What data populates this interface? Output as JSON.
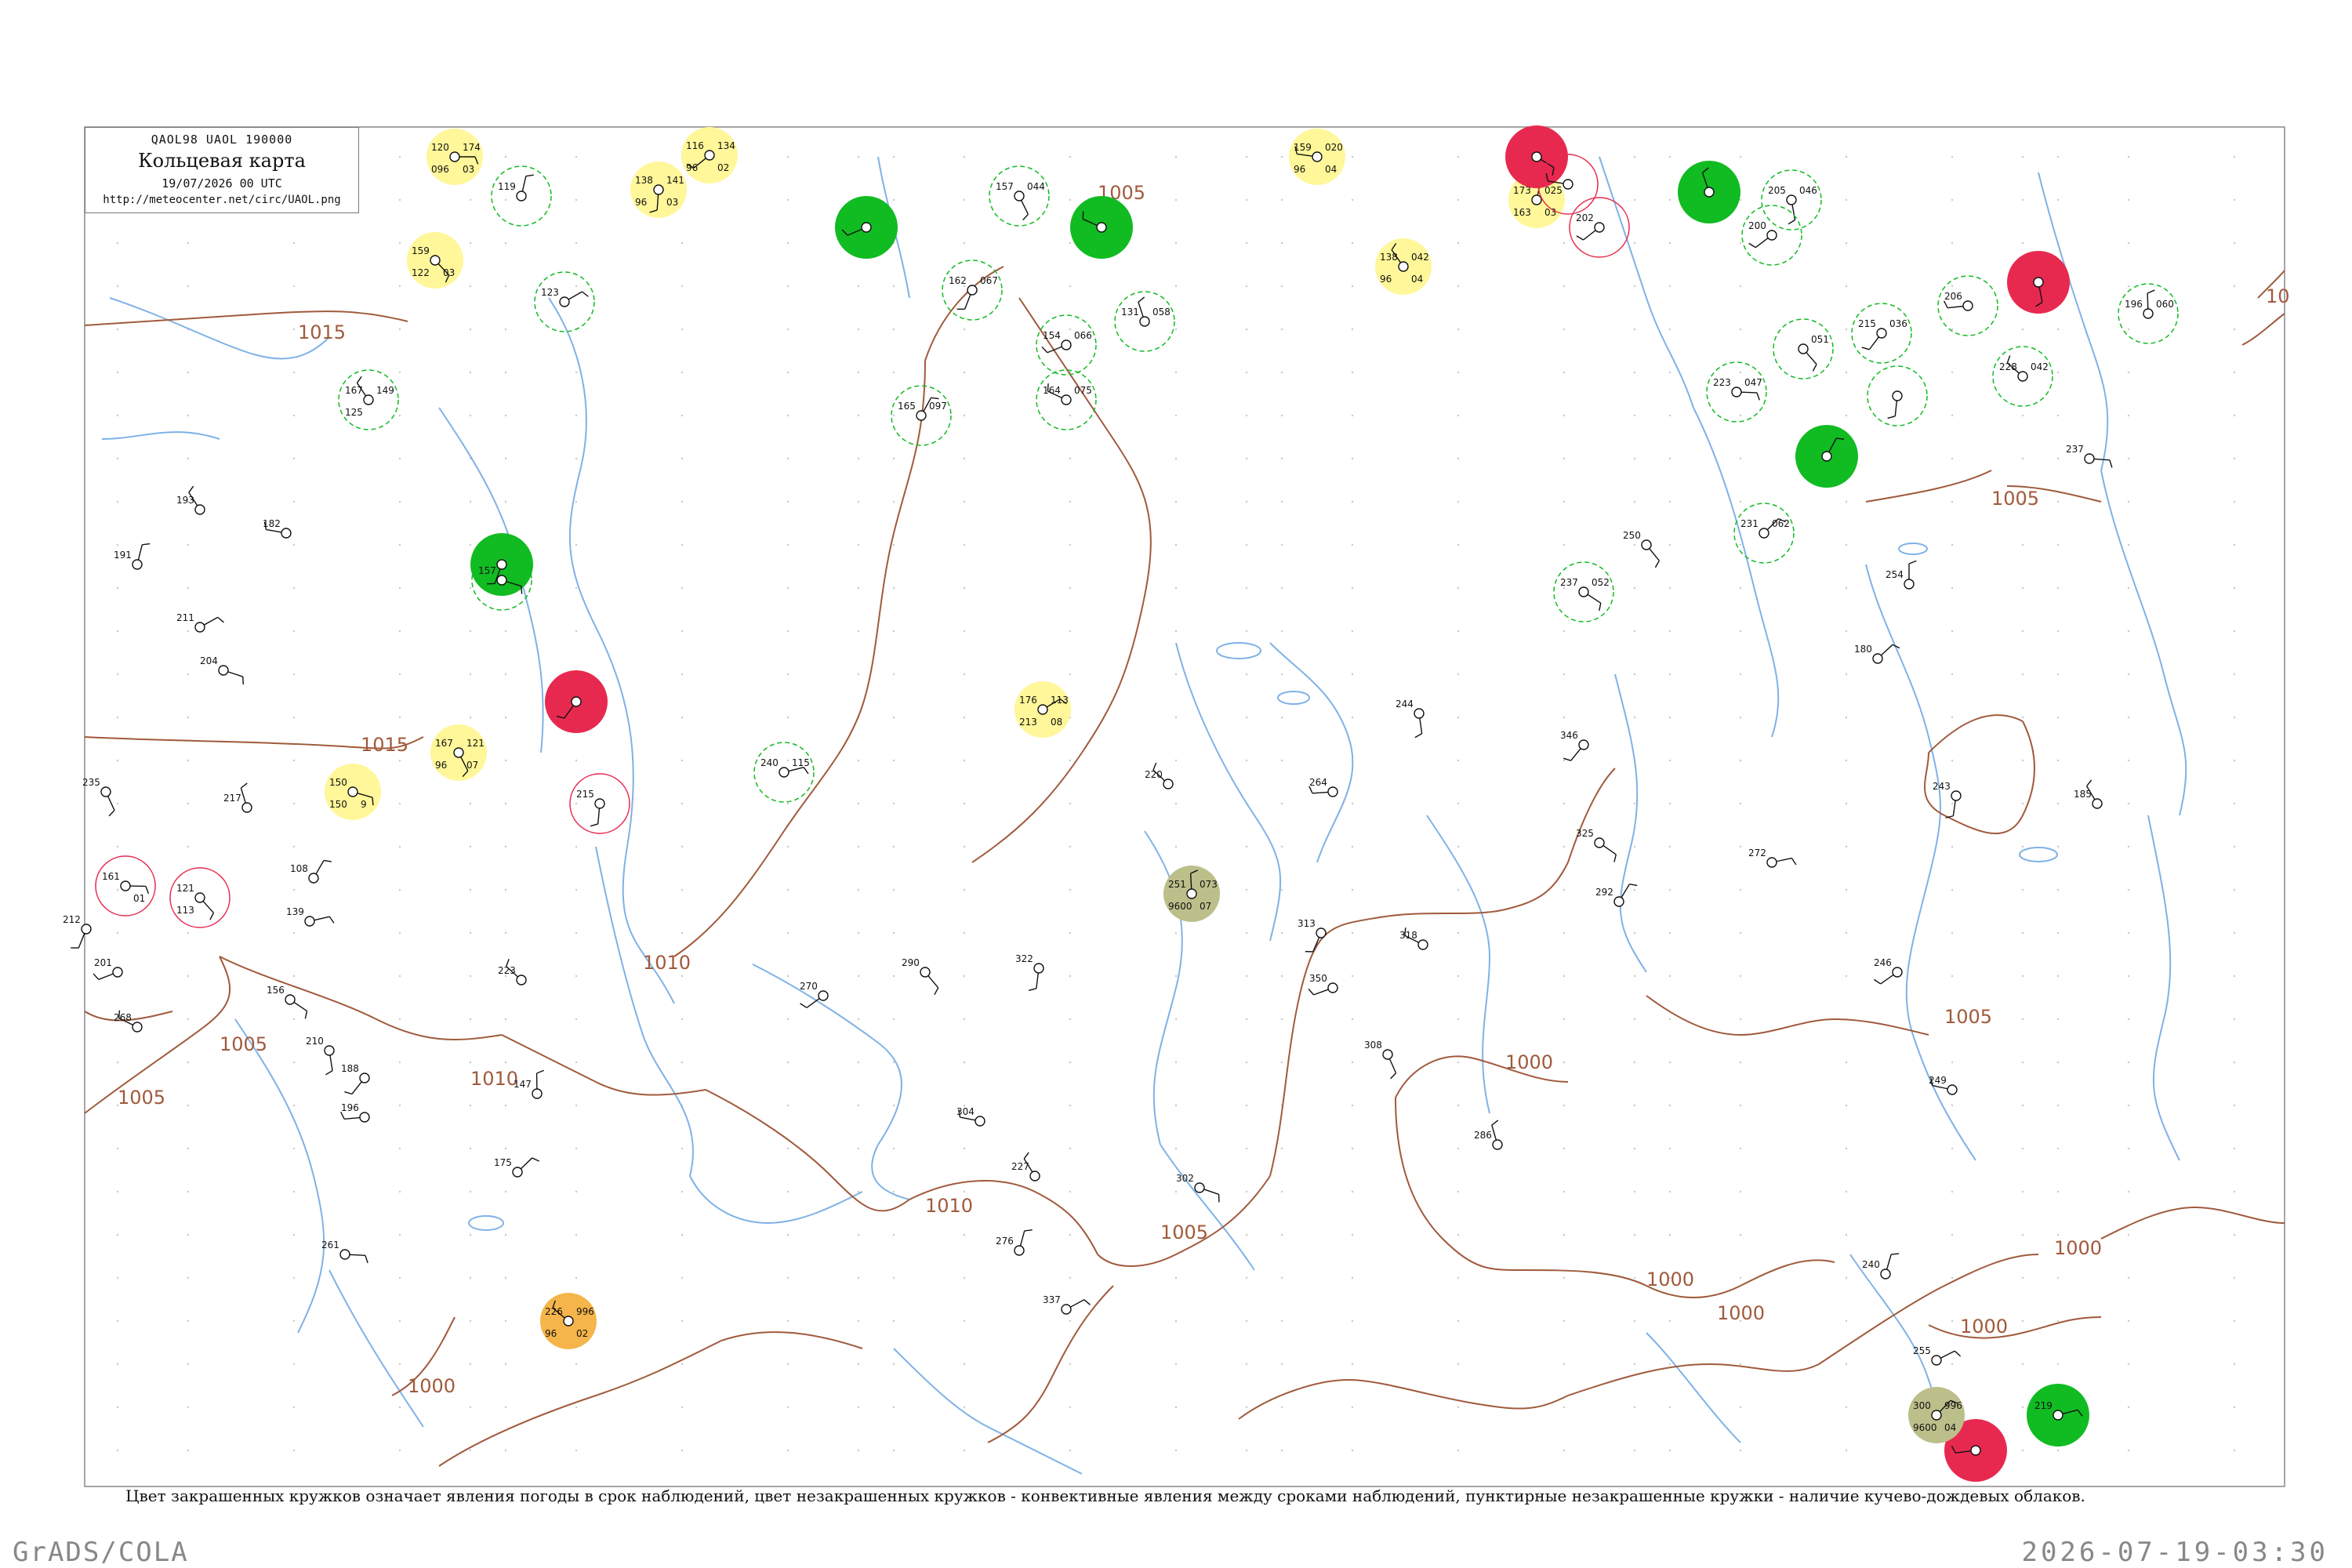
{
  "header": {
    "codes": "QAOL98 UAOL 190000",
    "title": "Кольцевая карта",
    "datetime": "19/07/2026 00 UTC",
    "url": "http://meteocenter.net/circ/UAOL.png"
  },
  "caption": "Цвет закрашенных кружков означает явления погоды в срок наблюдений, цвет незакрашенных кружков - конвективные явления между сроками наблюдений, пунктирные незакрашенные кружки - наличие кучево-дождевых облаков.",
  "footer": {
    "left": "GrADS/COLA",
    "right": "2026-07-19-03:30"
  },
  "colors": {
    "yellow": "#fff799",
    "green": "#11bb22",
    "red": "#e8294f",
    "orange": "#f5b54a",
    "olive": "#bcbf8a",
    "isobar": "#a05a3c",
    "river": "#7fb2e6",
    "frame": "#888888"
  },
  "isobar_labels": [
    "1015",
    "1015",
    "1010",
    "1010",
    "1005",
    "1005",
    "1005",
    "1005",
    "1000",
    "1000",
    "1000",
    "1000",
    "1000",
    "1000",
    "1005",
    "1010",
    "1005",
    "10"
  ],
  "stations": [
    {
      "t": "120",
      "p": "174",
      "td": "096",
      "pt": "03",
      "s": "yellow"
    },
    {
      "t": "159",
      "p": "",
      "td": "122",
      "pt": "03",
      "s": "yellow"
    },
    {
      "t": "138",
      "p": "141",
      "td": "96",
      "pt": "03",
      "s": "yellow"
    },
    {
      "t": "116",
      "p": "134",
      "td": "96",
      "pt": "02",
      "s": "yellow"
    },
    {
      "t": "159",
      "p": "020",
      "td": "96",
      "pt": "04",
      "s": "yellow"
    },
    {
      "t": "138",
      "p": "042",
      "td": "96",
      "pt": "04",
      "s": "yellow"
    },
    {
      "t": "173",
      "p": "025",
      "td": "163",
      "pt": "03",
      "s": "yellow"
    },
    {
      "t": "176",
      "p": "113",
      "td": "213",
      "pt": "08",
      "s": "yellow"
    },
    {
      "t": "150",
      "p": "",
      "td": "150",
      "pt": "9",
      "s": "yellow"
    },
    {
      "t": "167",
      "p": "121",
      "td": "96",
      "pt": "07",
      "s": "yellow"
    },
    {
      "t": "",
      "p": "",
      "td": "",
      "pt": "",
      "s": "green"
    },
    {
      "t": "",
      "p": "",
      "td": "",
      "pt": "",
      "s": "green"
    },
    {
      "t": "",
      "p": "",
      "td": "",
      "pt": "",
      "s": "green"
    },
    {
      "t": "",
      "p": "",
      "td": "",
      "pt": "",
      "s": "green"
    },
    {
      "t": "",
      "p": "",
      "td": "",
      "pt": "",
      "s": "green"
    },
    {
      "t": "219",
      "p": "",
      "td": "",
      "pt": "",
      "s": "green"
    },
    {
      "t": "",
      "p": "",
      "td": "",
      "pt": "",
      "s": "red"
    },
    {
      "t": "",
      "p": "",
      "td": "",
      "pt": "",
      "s": "red"
    },
    {
      "t": "",
      "p": "",
      "td": "",
      "pt": "",
      "s": "red"
    },
    {
      "t": "",
      "p": "",
      "td": "",
      "pt": "",
      "s": "red"
    },
    {
      "t": "226",
      "p": "996",
      "td": "96",
      "pt": "02",
      "s": "orange"
    },
    {
      "t": "251",
      "p": "073",
      "td": "9600",
      "pt": "07",
      "s": "olive"
    },
    {
      "t": "300",
      "p": "996",
      "td": "9600",
      "pt": "04",
      "s": "olive"
    },
    {
      "t": "161",
      "p": "",
      "td": "",
      "pt": "01",
      "s": "ring-red"
    },
    {
      "t": "121",
      "p": "",
      "td": "113",
      "pt": "",
      "s": "ring-red"
    },
    {
      "t": "215",
      "p": "",
      "td": "",
      "pt": "",
      "s": "ring-red"
    },
    {
      "t": "202",
      "p": "",
      "td": "",
      "pt": "",
      "s": "ring-red"
    },
    {
      "t": "",
      "p": "",
      "td": "",
      "pt": "",
      "s": "ring-red"
    },
    {
      "t": "167",
      "p": "149",
      "td": "125",
      "pt": "",
      "s": "ring-green"
    },
    {
      "t": "119",
      "p": "",
      "td": "",
      "pt": "",
      "s": "ring-green"
    },
    {
      "t": "123",
      "p": "",
      "td": "",
      "pt": "",
      "s": "ring-green"
    },
    {
      "t": "157",
      "p": "",
      "td": "",
      "pt": "",
      "s": "ring-green"
    },
    {
      "t": "157",
      "p": "044",
      "td": "",
      "pt": "",
      "s": "ring-green"
    },
    {
      "t": "162",
      "p": "067",
      "td": "",
      "pt": "",
      "s": "ring-green"
    },
    {
      "t": "154",
      "p": "066",
      "td": "",
      "pt": "",
      "s": "ring-green"
    },
    {
      "t": "164",
      "p": "075",
      "td": "",
      "pt": "",
      "s": "ring-green"
    },
    {
      "t": "131",
      "p": "058",
      "td": "",
      "pt": "",
      "s": "ring-green"
    },
    {
      "t": "165",
      "p": "097",
      "td": "",
      "pt": "",
      "s": "ring-green"
    },
    {
      "t": "240",
      "p": "115",
      "td": "",
      "pt": "",
      "s": "ring-green"
    },
    {
      "t": "237",
      "p": "052",
      "td": "",
      "pt": "",
      "s": "ring-green"
    },
    {
      "t": "205",
      "p": "046",
      "td": "",
      "pt": "",
      "s": "ring-green"
    },
    {
      "t": "215",
      "p": "036",
      "td": "",
      "pt": "",
      "s": "ring-green"
    },
    {
      "t": "206",
      "p": "",
      "td": "",
      "pt": "",
      "s": "ring-green"
    },
    {
      "t": "228",
      "p": "042",
      "td": "",
      "pt": "",
      "s": "ring-green"
    },
    {
      "t": "196",
      "p": "060",
      "td": "",
      "pt": "",
      "s": "ring-green"
    },
    {
      "t": "231",
      "p": "062",
      "td": "",
      "pt": "",
      "s": "ring-green"
    },
    {
      "t": "223",
      "p": "047",
      "td": "",
      "pt": "",
      "s": "ring-green"
    },
    {
      "t": "",
      "p": "051",
      "td": "",
      "pt": "",
      "s": "ring-green"
    },
    {
      "t": "",
      "p": "",
      "td": "",
      "pt": "",
      "s": "ring-green"
    },
    {
      "t": "200",
      "p": "",
      "td": "",
      "pt": "",
      "s": "ring-green"
    },
    {
      "t": "182",
      "p": "",
      "td": "",
      "pt": "",
      "s": "plain"
    },
    {
      "t": "193",
      "p": "",
      "td": "",
      "pt": "",
      "s": "plain"
    },
    {
      "t": "191",
      "p": "",
      "td": "",
      "pt": "",
      "s": "plain"
    },
    {
      "t": "211",
      "p": "",
      "td": "",
      "pt": "",
      "s": "plain"
    },
    {
      "t": "204",
      "p": "",
      "td": "",
      "pt": "",
      "s": "plain"
    },
    {
      "t": "235",
      "p": "",
      "td": "",
      "pt": "",
      "s": "plain"
    },
    {
      "t": "212",
      "p": "",
      "td": "",
      "pt": "",
      "s": "plain"
    },
    {
      "t": "201",
      "p": "",
      "td": "",
      "pt": "",
      "s": "plain"
    },
    {
      "t": "268",
      "p": "",
      "td": "",
      "pt": "",
      "s": "plain"
    },
    {
      "t": "217",
      "p": "",
      "td": "",
      "pt": "",
      "s": "plain"
    },
    {
      "t": "108",
      "p": "",
      "td": "",
      "pt": "",
      "s": "plain"
    },
    {
      "t": "139",
      "p": "",
      "td": "",
      "pt": "",
      "s": "plain"
    },
    {
      "t": "156",
      "p": "",
      "td": "",
      "pt": "",
      "s": "plain"
    },
    {
      "t": "210",
      "p": "",
      "td": "",
      "pt": "",
      "s": "plain"
    },
    {
      "t": "188",
      "p": "",
      "td": "",
      "pt": "",
      "s": "plain"
    },
    {
      "t": "196",
      "p": "",
      "td": "",
      "pt": "",
      "s": "plain"
    },
    {
      "t": "223",
      "p": "",
      "td": "",
      "pt": "",
      "s": "plain"
    },
    {
      "t": "147",
      "p": "",
      "td": "",
      "pt": "",
      "s": "plain"
    },
    {
      "t": "175",
      "p": "",
      "td": "",
      "pt": "",
      "s": "plain"
    },
    {
      "t": "261",
      "p": "",
      "td": "",
      "pt": "",
      "s": "plain"
    },
    {
      "t": "290",
      "p": "",
      "td": "",
      "pt": "",
      "s": "plain"
    },
    {
      "t": "322",
      "p": "",
      "td": "",
      "pt": "",
      "s": "plain"
    },
    {
      "t": "270",
      "p": "",
      "td": "",
      "pt": "",
      "s": "plain"
    },
    {
      "t": "304",
      "p": "",
      "td": "",
      "pt": "",
      "s": "plain"
    },
    {
      "t": "227",
      "p": "",
      "td": "",
      "pt": "",
      "s": "plain"
    },
    {
      "t": "276",
      "p": "",
      "td": "",
      "pt": "",
      "s": "plain"
    },
    {
      "t": "337",
      "p": "",
      "td": "",
      "pt": "",
      "s": "plain"
    },
    {
      "t": "302",
      "p": "",
      "td": "",
      "pt": "",
      "s": "plain"
    },
    {
      "t": "308",
      "p": "",
      "td": "",
      "pt": "",
      "s": "plain"
    },
    {
      "t": "313",
      "p": "",
      "td": "",
      "pt": "",
      "s": "plain"
    },
    {
      "t": "350",
      "p": "",
      "td": "",
      "pt": "",
      "s": "plain"
    },
    {
      "t": "318",
      "p": "",
      "td": "",
      "pt": "",
      "s": "plain"
    },
    {
      "t": "286",
      "p": "",
      "td": "",
      "pt": "",
      "s": "plain"
    },
    {
      "t": "292",
      "p": "",
      "td": "",
      "pt": "",
      "s": "plain"
    },
    {
      "t": "272",
      "p": "",
      "td": "",
      "pt": "",
      "s": "plain"
    },
    {
      "t": "325",
      "p": "",
      "td": "",
      "pt": "",
      "s": "plain"
    },
    {
      "t": "244",
      "p": "",
      "td": "",
      "pt": "",
      "s": "plain"
    },
    {
      "t": "346",
      "p": "",
      "td": "",
      "pt": "",
      "s": "plain"
    },
    {
      "t": "264",
      "p": "",
      "td": "",
      "pt": "",
      "s": "plain"
    },
    {
      "t": "220",
      "p": "",
      "td": "",
      "pt": "",
      "s": "plain"
    },
    {
      "t": "254",
      "p": "",
      "td": "",
      "pt": "",
      "s": "plain"
    },
    {
      "t": "180",
      "p": "",
      "td": "",
      "pt": "",
      "s": "plain"
    },
    {
      "t": "237",
      "p": "",
      "td": "",
      "pt": "",
      "s": "plain"
    },
    {
      "t": "250",
      "p": "",
      "td": "",
      "pt": "",
      "s": "plain"
    },
    {
      "t": "243",
      "p": "",
      "td": "",
      "pt": "",
      "s": "plain"
    },
    {
      "t": "246",
      "p": "",
      "td": "",
      "pt": "",
      "s": "plain"
    },
    {
      "t": "249",
      "p": "",
      "td": "",
      "pt": "",
      "s": "plain"
    },
    {
      "t": "185",
      "p": "",
      "td": "",
      "pt": "",
      "s": "plain"
    },
    {
      "t": "240",
      "p": "",
      "td": "",
      "pt": "",
      "s": "plain"
    },
    {
      "t": "255",
      "p": "",
      "td": "",
      "pt": "",
      "s": "plain"
    }
  ]
}
